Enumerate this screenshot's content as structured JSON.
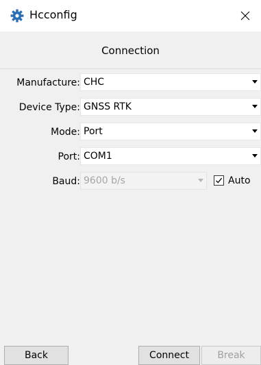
{
  "window": {
    "title": "Hcconfig",
    "icon": "gear-icon",
    "close_label": "×"
  },
  "header": {
    "title": "Connection"
  },
  "form": {
    "manufacture": {
      "label": "Manufacture:",
      "value": "CHC"
    },
    "device_type": {
      "label": "Device Type:",
      "value": "GNSS RTK"
    },
    "mode": {
      "label": "Mode:",
      "value": "Port"
    },
    "port": {
      "label": "Port:",
      "value": "COM1"
    },
    "baud": {
      "label": "Baud:",
      "value": "9600 b/s",
      "enabled": false
    },
    "auto": {
      "label": "Auto",
      "checked": true
    }
  },
  "buttons": {
    "back": "Back",
    "connect": "Connect",
    "break": "Break"
  },
  "colors": {
    "icon_blue": "#2b6fb5",
    "panel_bg": "#f0f0f0",
    "disabled_text": "#a6a6a6"
  }
}
